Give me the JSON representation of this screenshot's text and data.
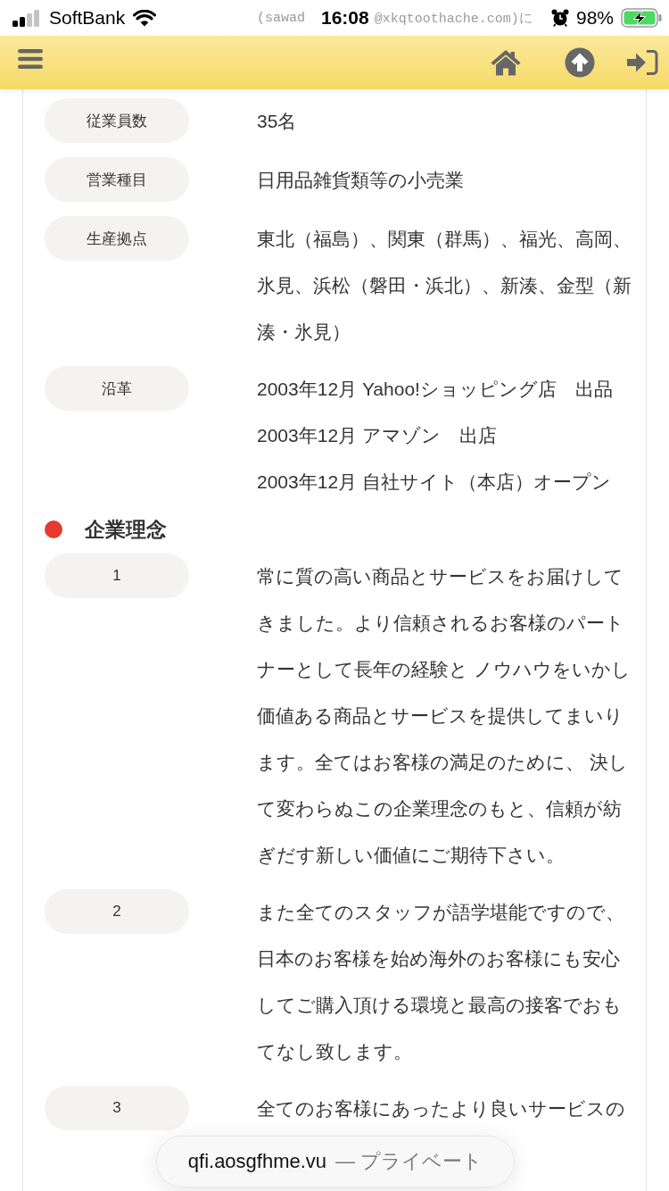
{
  "status_bar": {
    "carrier": "SoftBank",
    "marquee": [
      "(sawad",
      "@xkqtoothache.com)に"
    ],
    "time": "16:08",
    "battery": "98%"
  },
  "company_info": {
    "rows": [
      {
        "kind": "text",
        "label": "従業員数",
        "value": "35名"
      },
      {
        "kind": "text",
        "label": "営業種目",
        "value": "日用品雑貨類等の小売業"
      },
      {
        "kind": "text",
        "label": "生産拠点",
        "value": "東北（福島）、関東（群馬）、福光、高岡、氷見、浜松（磐田・浜北）、新湊、金型（新湊・氷見）"
      },
      {
        "kind": "history",
        "label": "沿革",
        "entries": [
          "2003年12月 Yahoo!ショッピング店　出品",
          "2003年12月 アマゾン　出店",
          "2003年12月 自社サイト（本店）オープン"
        ]
      }
    ]
  },
  "philosophy": {
    "title": "企業理念",
    "rows": [
      {
        "kind": "text",
        "label": "1",
        "value": "常に質の高い商品とサービスをお届けしてきました。より信頼されるお客様のパートナーとして長年の経験と ノウハウをいかし価値ある商品とサービスを提供してまいります。全てはお客様の満足のために、 決して変わらぬこの企業理念のもと、信頼が紡ぎだす新しい価値にご期待下さい。"
      },
      {
        "kind": "text",
        "label": "2",
        "value": "また全てのスタッフが語学堪能ですので、日本のお客様を始め海外のお客様にも安心してご購入頂ける環境と最高の接客でおもてなし致します。"
      },
      {
        "kind": "text",
        "label": "3",
        "value": "全てのお客様にあったより良いサービスの"
      }
    ]
  },
  "address_bar": {
    "domain": "qfi.aosgfhme.vu",
    "mode": "— プライベート"
  }
}
